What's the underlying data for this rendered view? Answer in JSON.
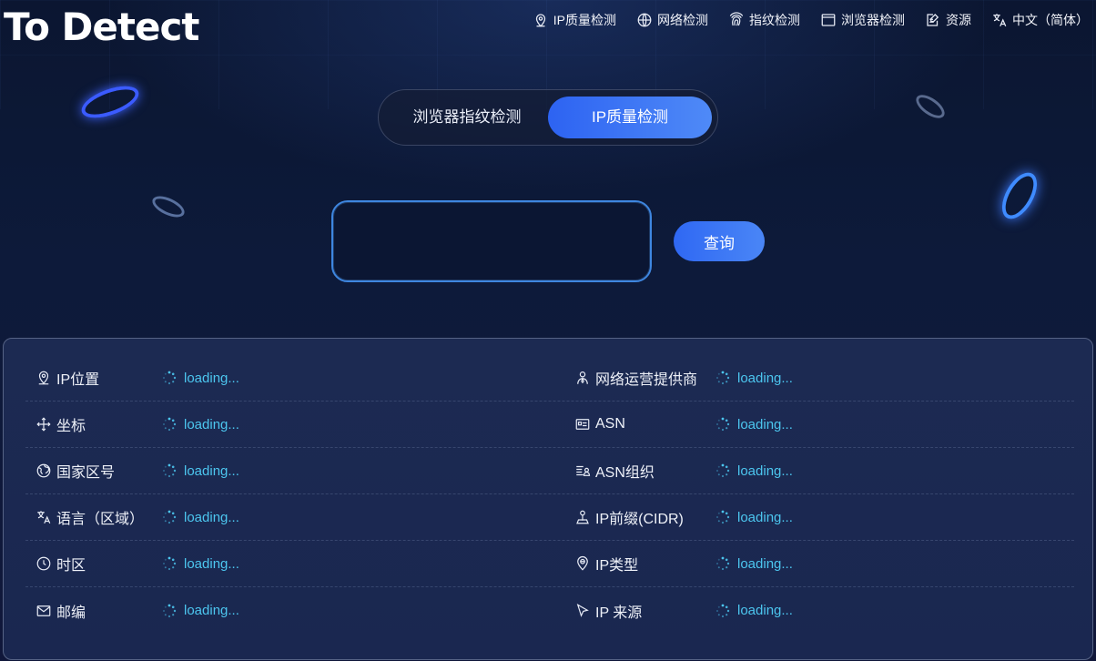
{
  "header": {
    "logo": "To Detect",
    "nav": [
      {
        "icon": "location-pin-icon",
        "label": "IP质量检测"
      },
      {
        "icon": "globe-icon",
        "label": "网络检测"
      },
      {
        "icon": "fingerprint-icon",
        "label": "指纹检测"
      },
      {
        "icon": "browser-window-icon",
        "label": "浏览器检测"
      },
      {
        "icon": "edit-document-icon",
        "label": "资源"
      },
      {
        "icon": "translate-icon",
        "label": "中文（简体）"
      }
    ]
  },
  "mode_switch": {
    "options": [
      "浏览器指纹检测",
      "IP质量检测"
    ],
    "active": "IP质量检测"
  },
  "search": {
    "value": "",
    "button": "查询"
  },
  "results": {
    "left": [
      {
        "icon": "location-pin-icon",
        "label": "IP位置",
        "value": "loading..."
      },
      {
        "icon": "move-arrows-icon",
        "label": "坐标",
        "value": "loading..."
      },
      {
        "icon": "earth-icon",
        "label": "国家区号",
        "value": "loading..."
      },
      {
        "icon": "translate-icon",
        "label": "语言（区域）",
        "value": "loading..."
      },
      {
        "icon": "clock-icon",
        "label": "时区",
        "value": "loading..."
      },
      {
        "icon": "mail-icon",
        "label": "邮编",
        "value": "loading..."
      }
    ],
    "right": [
      {
        "icon": "user-icon",
        "label": "网络运营提供商",
        "value": "loading..."
      },
      {
        "icon": "id-card-icon",
        "label": "ASN",
        "value": "loading..."
      },
      {
        "icon": "org-card-icon",
        "label": "ASN组织",
        "value": "loading..."
      },
      {
        "icon": "person-pin-icon",
        "label": "IP前缀(CIDR)",
        "value": "loading..."
      },
      {
        "icon": "map-marker-icon",
        "label": "IP类型",
        "value": "loading..."
      },
      {
        "icon": "cursor-pointer-icon",
        "label": "IP 来源",
        "value": "loading..."
      }
    ]
  },
  "colors": {
    "accent": "#3b74f4",
    "loading_text": "#4cc6ef",
    "background": "#0d1a3a"
  }
}
